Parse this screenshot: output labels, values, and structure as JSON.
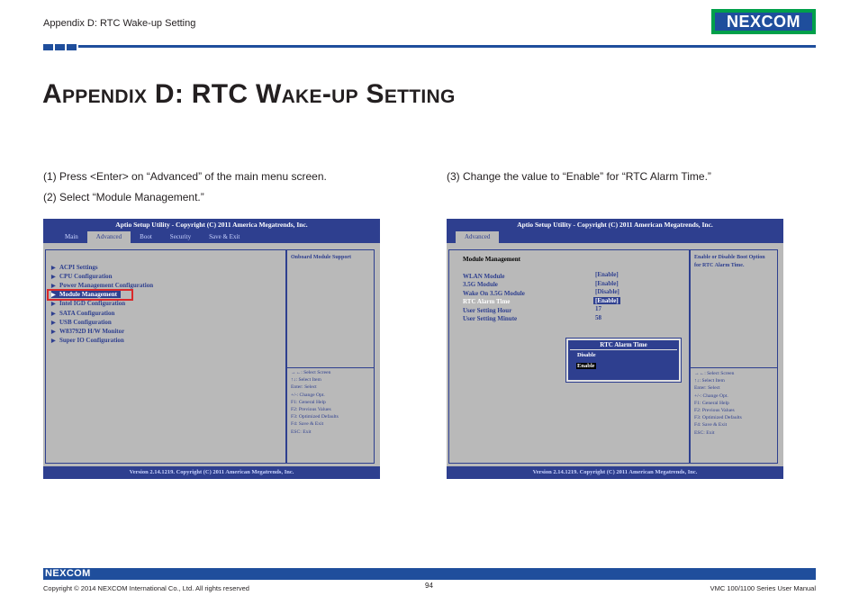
{
  "header": {
    "section_label": "Appendix D: RTC Wake-up Setting",
    "logo_text": "NEXCOM"
  },
  "title": "Appendix D: RTC Wake-up Setting",
  "steps": {
    "step1": "(1) Press <Enter> on “Advanced” of the main menu screen.",
    "step2": "(2) Select “Module Management.”",
    "step3": "(3) Change the value to “Enable” for “RTC Alarm Time.”"
  },
  "bios_left": {
    "top_title": "Aptio Setup Utility - Copyright (C) 2011 America Megatrends, Inc.",
    "tabs": [
      "Main",
      "Advanced",
      "Boot",
      "Security",
      "Save & Exit"
    ],
    "active_tab": "Advanced",
    "menu_items": [
      "ACPI Settings",
      "CPU Configuration",
      "Power Management Configuration",
      "Module Management",
      "Intel IGD Configuration",
      "SATA Configuration",
      "USB Configuration",
      "W83792D H/W Monitor",
      "Super IO Configuration"
    ],
    "selected_item": "Module Management",
    "help": "Onboard Module Support",
    "keys": [
      "→←: Select Screen",
      "↑↓: Select Item",
      "Enter: Select",
      "+/-: Change Opt.",
      "F1: General Help",
      "F2: Previous Values",
      "F3: Optimized Defaults",
      "F4: Save & Exit",
      "ESC: Exit"
    ],
    "bottom": "Version 2.14.1219. Copyright (C) 2011 American Megatrends, Inc."
  },
  "bios_right": {
    "top_title": "Aptio Setup Utility - Copyright (C) 2011 American Megatrends, Inc.",
    "active_tab": "Advanced",
    "section_title": "Module Management",
    "settings": [
      {
        "label": "WLAN Module",
        "value": "[Enable]"
      },
      {
        "label": "3.5G Module",
        "value": "[Enable]"
      },
      {
        "label": "Wake On 3.5G Module",
        "value": "[Disable]"
      },
      {
        "label": "RTC Alarm Time",
        "value": "[Enable]"
      },
      {
        "label": "User Setting Hour",
        "value": "17"
      },
      {
        "label": "User Setting Minute",
        "value": "58"
      }
    ],
    "help_line1": "Enable or Disable Boot Option",
    "help_line2": "for RTC Alarm Time.",
    "popup": {
      "title": "RTC Alarm Time",
      "options": [
        "Disable",
        "Enable"
      ],
      "selected": "Enable"
    },
    "keys": [
      "→←: Select Screen",
      "↑↓: Select Item",
      "Enter: Select",
      "+/-: Change Opt.",
      "F1: General Help",
      "F2: Previous Values",
      "F3: Optimized Defaults",
      "F4: Save & Exit",
      "ESC: Exit"
    ],
    "bottom": "Version 2.14.1219. Copyright (C) 2011 American Megatrends, Inc."
  },
  "footer": {
    "logo_text": "NEXCOM",
    "copyright": "Copyright © 2014 NEXCOM International Co., Ltd. All rights reserved",
    "page_number": "94",
    "manual": "VMC 100/1100 Series User Manual"
  },
  "colors": {
    "brand_blue": "#1f4e9c",
    "brand_green": "#00a04a",
    "bios_blue": "#2e3f8f",
    "bios_gray": "#b9b9b9",
    "highlight_red": "#d9292b"
  }
}
